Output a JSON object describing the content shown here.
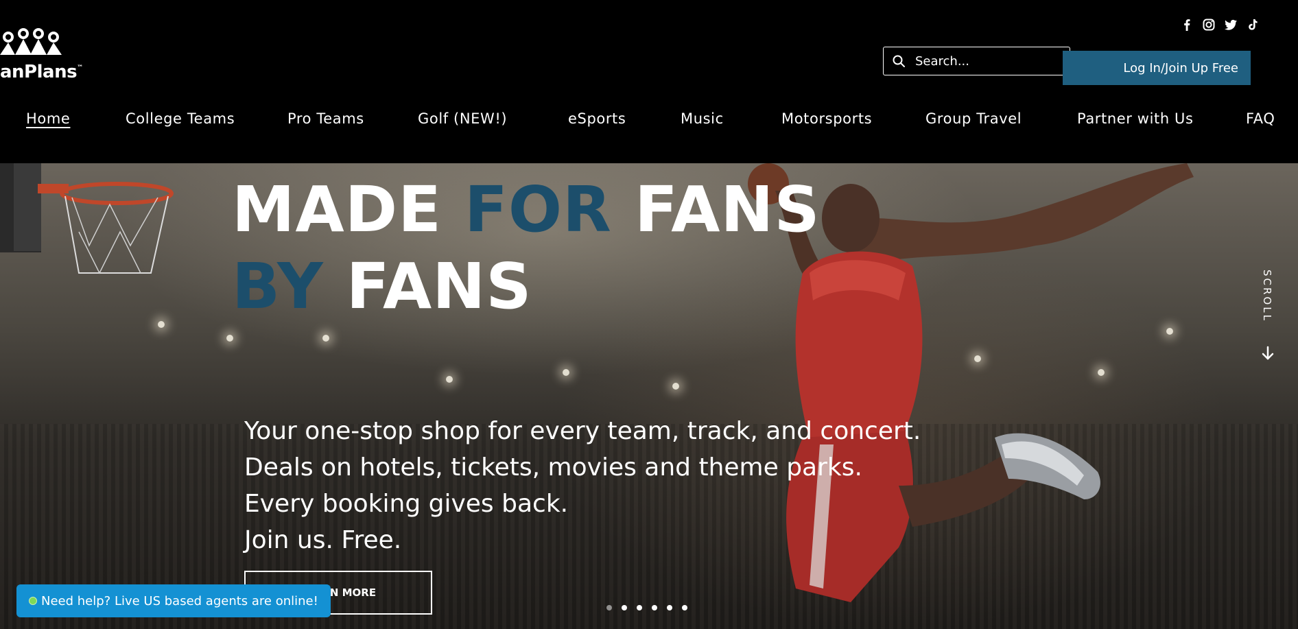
{
  "header": {
    "logo_text": "anPlans",
    "logo_tm": "™",
    "social": [
      {
        "name": "facebook-icon",
        "glyph": "f"
      },
      {
        "name": "instagram-icon",
        "glyph": "instagram"
      },
      {
        "name": "twitter-icon",
        "glyph": "twitter"
      },
      {
        "name": "tiktok-icon",
        "glyph": "tiktok"
      }
    ],
    "search_placeholder": "Search...",
    "login_label": "Log In/Join Up Free"
  },
  "nav": {
    "items": [
      {
        "label": "Home",
        "active": true
      },
      {
        "label": "College Teams",
        "active": false
      },
      {
        "label": "Pro Teams",
        "active": false
      },
      {
        "label": "Golf (NEW!)",
        "active": false
      },
      {
        "label": "eSports",
        "active": false
      },
      {
        "label": "Music",
        "active": false
      },
      {
        "label": "Motorsports",
        "active": false
      },
      {
        "label": "Group Travel",
        "active": false
      },
      {
        "label": "Partner with Us",
        "active": false
      },
      {
        "label": "FAQ",
        "active": false
      }
    ]
  },
  "hero": {
    "headline": {
      "w1": "MADE",
      "w2": "FOR",
      "w3": "FANS",
      "w4": "BY",
      "w5": "FANS"
    },
    "tagline": [
      "Your one-stop shop for every team, track, and concert.",
      "Deals on hotels, tickets, movies and theme parks.",
      "Every booking gives back.",
      "Join us. Free."
    ],
    "learn_more_label": "LEARN MORE",
    "scroll_label": "SCROLL",
    "slide_count": 6,
    "active_slide": 1
  },
  "help_chip": {
    "label": "Need help? Live US based agents are online!"
  },
  "colors": {
    "accent_blue": "#1c4e6b",
    "login_button": "#1f5f80",
    "help_chip": "#1491d3",
    "online_dot": "#7ed957"
  }
}
